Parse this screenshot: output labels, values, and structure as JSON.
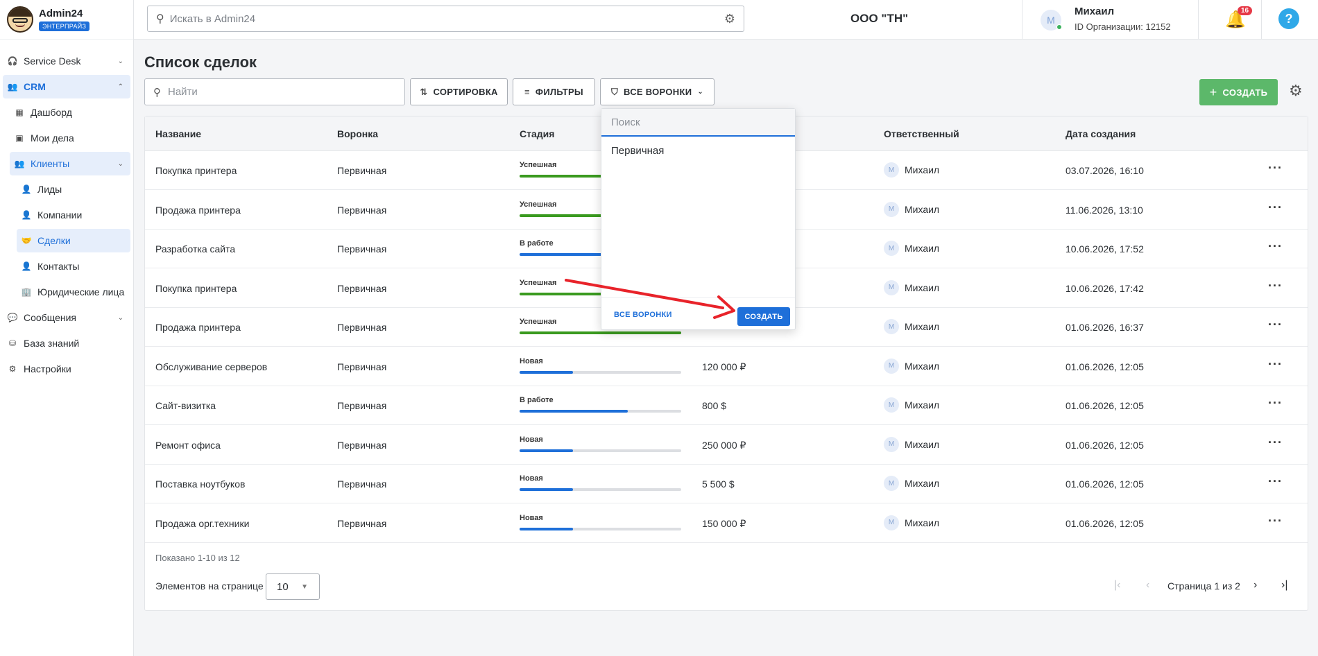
{
  "brand": {
    "title": "Admin24",
    "badge": "ЭНТЕРПРАЙЗ"
  },
  "sidebar": {
    "items": [
      {
        "label": "Service Desk",
        "icon": "headset-icon"
      },
      {
        "label": "CRM",
        "icon": "people-icon"
      },
      {
        "label": "Дашборд",
        "icon": "dashboard-icon"
      },
      {
        "label": "Мои дела",
        "icon": "calendar-icon"
      },
      {
        "label": "Клиенты",
        "icon": "people-icon"
      },
      {
        "label": "Лиды",
        "icon": "person-icon"
      },
      {
        "label": "Компании",
        "icon": "person-icon"
      },
      {
        "label": "Сделки",
        "icon": "handshake-icon"
      },
      {
        "label": "Контакты",
        "icon": "person-icon"
      },
      {
        "label": "Юридические лица",
        "icon": "building-icon"
      },
      {
        "label": "Сообщения",
        "icon": "chat-icon"
      },
      {
        "label": "База знаний",
        "icon": "database-icon"
      },
      {
        "label": "Настройки",
        "icon": "gear-icon"
      }
    ]
  },
  "topbar": {
    "search_placeholder": "Искать в Admin24",
    "org_name": "ООО \"ТН\"",
    "user_initial": "M",
    "user_name": "Михаил",
    "user_org_id": "ID Организации: 12152",
    "notifications_count": "16",
    "help_label": "?"
  },
  "page": {
    "title": "Список сделок",
    "search_placeholder": "Найти",
    "sort_label": "СОРТИРОВКА",
    "filters_label": "ФИЛЬТРЫ",
    "funnels_label": "ВСЕ ВОРОНКИ",
    "create_label": "СОЗДАТЬ"
  },
  "table": {
    "headers": [
      "Название",
      "Воронка",
      "Стадия",
      "Ответственный",
      "Дата создания"
    ],
    "rows": [
      {
        "name": "Покупка принтера",
        "funnel": "Первичная",
        "stage": "Успешная",
        "progress": 1.0,
        "color": "#3a9a1f",
        "amount": "",
        "resp_initial": "M",
        "resp": "Михаил",
        "date": "03.07.2026, 16:10"
      },
      {
        "name": "Продажа принтера",
        "funnel": "Первичная",
        "stage": "Успешная",
        "progress": 1.0,
        "color": "#3a9a1f",
        "amount": "",
        "resp_initial": "M",
        "resp": "Михаил",
        "date": "11.06.2026, 13:10"
      },
      {
        "name": "Разработка сайта",
        "funnel": "Первичная",
        "stage": "В работе",
        "progress": 0.67,
        "color": "#1e6fd9",
        "amount": "",
        "resp_initial": "M",
        "resp": "Михаил",
        "date": "10.06.2026, 17:52"
      },
      {
        "name": "Покупка принтера",
        "funnel": "Первичная",
        "stage": "Успешная",
        "progress": 1.0,
        "color": "#3a9a1f",
        "amount": "",
        "resp_initial": "M",
        "resp": "Михаил",
        "date": "10.06.2026, 17:42"
      },
      {
        "name": "Продажа принтера",
        "funnel": "Первичная",
        "stage": "Успешная",
        "progress": 1.0,
        "color": "#3a9a1f",
        "amount": "",
        "resp_initial": "M",
        "resp": "Михаил",
        "date": "01.06.2026, 16:37"
      },
      {
        "name": "Обслуживание серверов",
        "funnel": "Первичная",
        "stage": "Новая",
        "progress": 0.33,
        "color": "#1e6fd9",
        "amount": "120 000 ₽",
        "resp_initial": "M",
        "resp": "Михаил",
        "date": "01.06.2026, 12:05"
      },
      {
        "name": "Сайт-визитка",
        "funnel": "Первичная",
        "stage": "В работе",
        "progress": 0.67,
        "color": "#1e6fd9",
        "amount": "800 $",
        "resp_initial": "M",
        "resp": "Михаил",
        "date": "01.06.2026, 12:05"
      },
      {
        "name": "Ремонт офиса",
        "funnel": "Первичная",
        "stage": "Новая",
        "progress": 0.33,
        "color": "#1e6fd9",
        "amount": "250 000 ₽",
        "resp_initial": "M",
        "resp": "Михаил",
        "date": "01.06.2026, 12:05"
      },
      {
        "name": "Поставка ноутбуков",
        "funnel": "Первичная",
        "stage": "Новая",
        "progress": 0.33,
        "color": "#1e6fd9",
        "amount": "5 500 $",
        "resp_initial": "M",
        "resp": "Михаил",
        "date": "01.06.2026, 12:05"
      },
      {
        "name": "Продажа орг.техники",
        "funnel": "Первичная",
        "stage": "Новая",
        "progress": 0.33,
        "color": "#1e6fd9",
        "amount": "150 000 ₽",
        "resp_initial": "M",
        "resp": "Михаил",
        "date": "01.06.2026, 12:05"
      }
    ],
    "shown_text": "Показано 1-10 из 12",
    "per_page_label": "Элементов на странице",
    "per_page_value": "10",
    "page_text": "Страница 1 из 2"
  },
  "dropdown": {
    "search_placeholder": "Поиск",
    "option": "Первичная",
    "all_label": "ВСЕ ВОРОНКИ",
    "create_label": "СОЗДАТЬ"
  },
  "colors": {
    "accent": "#1e6fd9",
    "success": "#3a9a1f",
    "create": "#5cb86a",
    "annotation_arrow": "#e8232a"
  }
}
